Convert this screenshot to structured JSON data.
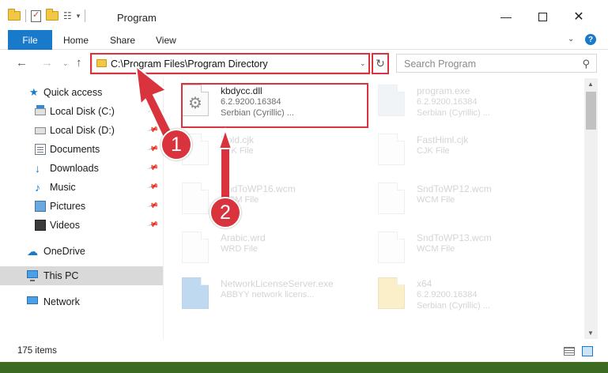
{
  "window": {
    "title": "Program",
    "controls": {
      "minimize": "—",
      "maximize": "",
      "close": "✕"
    }
  },
  "ribbon": {
    "tabs": [
      "File",
      "Home",
      "Share",
      "View"
    ],
    "help": "?"
  },
  "address": {
    "path": "C:\\Program Files\\Program Directory",
    "search_placeholder": "Search Program"
  },
  "sidebar": {
    "items": [
      {
        "label": "Quick access",
        "icon": "star-icon",
        "pinned": false
      },
      {
        "label": "Local Disk (C:)",
        "icon": "drive-icon",
        "pinned": true
      },
      {
        "label": "Local Disk (D:)",
        "icon": "drive-icon",
        "pinned": true
      },
      {
        "label": "Documents",
        "icon": "documents-icon",
        "pinned": true
      },
      {
        "label": "Downloads",
        "icon": "download-icon",
        "pinned": true
      },
      {
        "label": "Music",
        "icon": "music-icon",
        "pinned": true
      },
      {
        "label": "Pictures",
        "icon": "pictures-icon",
        "pinned": true
      },
      {
        "label": "Videos",
        "icon": "videos-icon",
        "pinned": true
      },
      {
        "label": "OneDrive",
        "icon": "cloud-icon",
        "pinned": false
      },
      {
        "label": "This PC",
        "icon": "computer-icon",
        "pinned": false,
        "selected": true
      },
      {
        "label": "Network",
        "icon": "network-icon",
        "pinned": false
      }
    ]
  },
  "files": [
    {
      "name": "kbdycc.dll",
      "line1": "6.2.9200.16384",
      "line2": "Serbian (Cyrillic) ...",
      "icon": "dll-icon",
      "highlighted": true
    },
    {
      "name": "program.exe",
      "line1": "6.2.9200.16384",
      "line2": "Serbian (Cyrillic) ...",
      "icon": "exe-icon"
    },
    {
      "name": "Bold.cjk",
      "line1": "CJK File",
      "line2": "",
      "icon": "file-icon"
    },
    {
      "name": "FastHiml.cjk",
      "line1": "CJK File",
      "line2": "",
      "icon": "file-icon"
    },
    {
      "name": "SndToWP16.wcm",
      "line1": "WCM File",
      "line2": "",
      "icon": "file-icon"
    },
    {
      "name": "SndToWP12.wcm",
      "line1": "WCM File",
      "line2": "",
      "icon": "file-icon"
    },
    {
      "name": "Arabic.wrd",
      "line1": "WRD File",
      "line2": "",
      "icon": "file-icon"
    },
    {
      "name": "SndToWP13.wcm",
      "line1": "WCM File",
      "line2": "",
      "icon": "file-icon"
    },
    {
      "name": "NetworkLicenseServer.exe",
      "line1": "ABBYY network licens...",
      "line2": "",
      "icon": "network-exe-icon"
    },
    {
      "name": "x64",
      "line1": "6.2.9200.16384",
      "line2": "Serbian (Cyrillic) ...",
      "icon": "folder-icon"
    }
  ],
  "status": {
    "item_count": "175 items"
  },
  "callouts": {
    "one": "1",
    "two": "2"
  },
  "colors": {
    "accent": "#1979ca",
    "highlight": "#d9333d"
  }
}
